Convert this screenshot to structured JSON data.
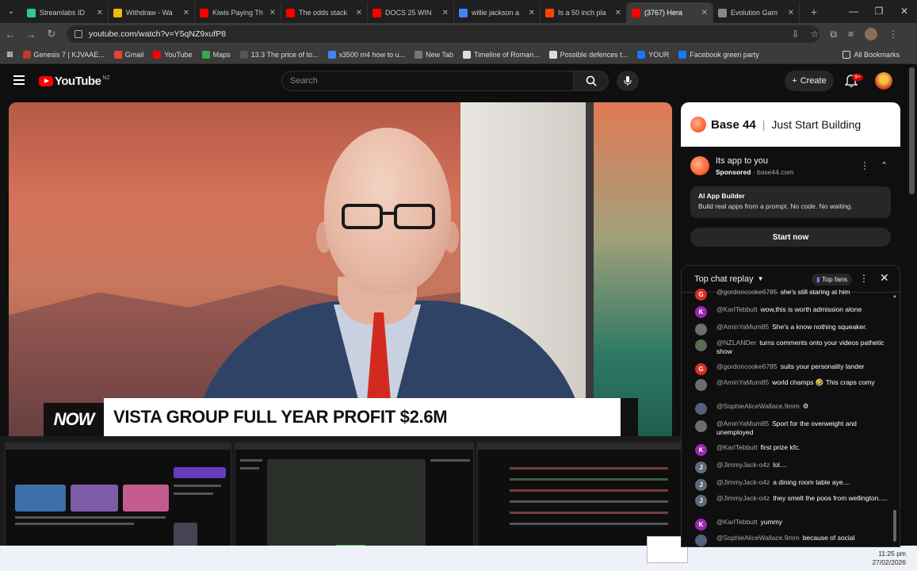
{
  "browser": {
    "tabs": [
      {
        "title": "Streamlabs ID",
        "color": "#31c3a2"
      },
      {
        "title": "Withdraw - Wa",
        "color": "#f0b90b"
      },
      {
        "title": "Kiwis Paying Th",
        "color": "#ff0000"
      },
      {
        "title": "The odds stack",
        "color": "#ff0000"
      },
      {
        "title": "DOCS 25 WIN",
        "color": "#ff0000"
      },
      {
        "title": "willie jackson a",
        "color": "#4285f4"
      },
      {
        "title": "Is a 50 inch pla",
        "color": "#ff4500"
      },
      {
        "title": "(3767) Hera",
        "color": "#ff0000"
      },
      {
        "title": "Evolution Gam",
        "color": "#888888"
      }
    ],
    "url": "youtube.com/watch?v=Y5qNZ9xufP8",
    "bookmarks": [
      {
        "label": "Genesis 7 | KJVAAE...",
        "color": "#c0392b"
      },
      {
        "label": "Gmail",
        "color": "#ea4335"
      },
      {
        "label": "YouTube",
        "color": "#ff0000"
      },
      {
        "label": "Maps",
        "color": "#34a853"
      },
      {
        "label": "13.3 The price of to...",
        "color": "#555555"
      },
      {
        "label": "x3500 m4 how to u...",
        "color": "#4285f4"
      },
      {
        "label": "New Tab",
        "color": "#777777"
      },
      {
        "label": "Timeline of Roman...",
        "color": "#dddddd"
      },
      {
        "label": "Possible defences t...",
        "color": "#dddddd"
      },
      {
        "label": "YOUR",
        "color": "#1877f2"
      },
      {
        "label": "Facebook green party",
        "color": "#1877f2"
      }
    ],
    "all_bookmarks": "All Bookmarks"
  },
  "youtube": {
    "logo": "YouTube",
    "region": "NZ",
    "search_placeholder": "Search",
    "create_label": "Create",
    "notifications_badge": "9+"
  },
  "video": {
    "badge": "NOW",
    "headline": "VISTA GROUP FULL YEAR PROFIT $2.6M"
  },
  "ad": {
    "brand": "Base 44",
    "tagline": "Just Start Building",
    "title": "Its app to you",
    "sponsored": "Sponsored",
    "domain": "base44.com",
    "card_title": "AI App Builder",
    "card_text": "Build real apps from a prompt. No code. No waiting.",
    "cta": "Start now"
  },
  "chat": {
    "mode": "Top chat replay",
    "top_fans": "Top fans",
    "messages": [
      {
        "author": "@gordoncooke6785",
        "text": "she's still staring at him",
        "initial": "G",
        "color": "#d93025"
      },
      {
        "author": "@KarlTebbutt",
        "text": "wow,this is worth admission alone",
        "initial": "K",
        "color": "#9c27b0"
      },
      {
        "author": "@AminYaMum85",
        "text": "She's a know nothing squeaker.",
        "initial": "",
        "color": "#6d6d6d"
      },
      {
        "author": "@NZLANDer",
        "text": "turns comments onto your videos pathetic show",
        "initial": "",
        "color": "#5b6b4f"
      },
      {
        "author": "@gordoncooke6785",
        "text": "suits your personality lander",
        "initial": "G",
        "color": "#d93025"
      },
      {
        "author": "@AminYaMum85",
        "text": "world champs 🤣 This craps comy",
        "initial": "",
        "color": "#6d6d6d"
      },
      {
        "author": "@SophieAliceWallace.9mm",
        "text": "⚙",
        "initial": "",
        "color": "#55607a"
      },
      {
        "author": "@AminYaMum85",
        "text": "Sport for the overweight and unemployed",
        "initial": "",
        "color": "#6d6d6d"
      },
      {
        "author": "@KarlTebbutt",
        "text": "first prize kfc.",
        "initial": "K",
        "color": "#9c27b0"
      },
      {
        "author": "@JimmyJack-o4z",
        "text": "lol....",
        "initial": "J",
        "color": "#5f6b7a"
      },
      {
        "author": "@JimmyJack-o4z",
        "text": "a dining room table aye....",
        "initial": "J",
        "color": "#5f6b7a"
      },
      {
        "author": "@JimmyJack-o4z",
        "text": "they smelt the poos from wellington.....",
        "initial": "J",
        "color": "#5f6b7a"
      },
      {
        "author": "@KarlTebbutt",
        "text": "yummy",
        "initial": "K",
        "color": "#9c27b0"
      },
      {
        "author": "@SophieAliceWallace.9mm",
        "text": "because of social",
        "initial": "",
        "color": "#55607a"
      }
    ]
  },
  "system": {
    "time": "11:25 pm",
    "date": "27/02/2026"
  }
}
